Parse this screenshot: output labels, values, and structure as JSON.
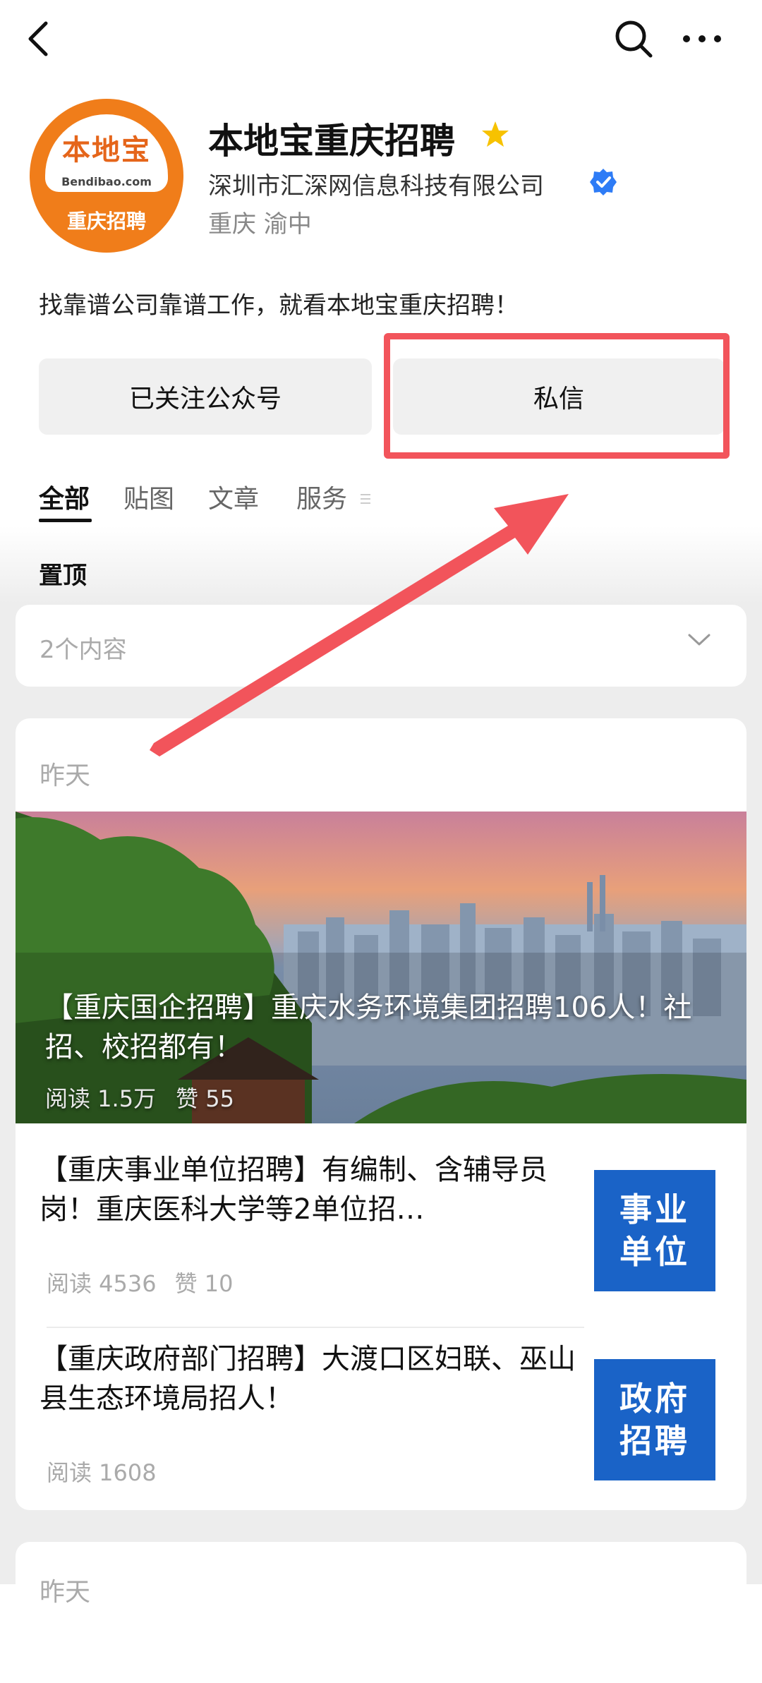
{
  "profile": {
    "avatar_line1": "本地宝",
    "avatar_line2": "Bendibao.com",
    "avatar_line3": "重庆招聘",
    "name": "本地宝重庆招聘",
    "company": "深圳市汇深网信息科技有限公司",
    "location": "重庆 渝中",
    "description": "找靠谱公司靠谱工作，就看本地宝重庆招聘！"
  },
  "actions": {
    "follow_label": "已关注公众号",
    "message_label": "私信"
  },
  "tabs": [
    "全部",
    "贴图",
    "文章",
    "服务"
  ],
  "pinned": {
    "label": "置顶",
    "count_text": "2个内容"
  },
  "feed": [
    {
      "date": "昨天",
      "hero": {
        "title": "【重庆国企招聘】重庆水务环境集团招聘106人！社招、校招都有！",
        "reads": "阅读 1.5万",
        "likes": "赞 55"
      },
      "articles": [
        {
          "title": "【重庆事业单位招聘】有编制、含辅导员岗！重庆医科大学等2单位招…",
          "reads": "阅读 4536",
          "likes": "赞 10",
          "thumb_line1": "事业",
          "thumb_line2": "单位"
        },
        {
          "title": "【重庆政府部门招聘】大渡口区妇联、巫山县生态环境局招人！",
          "reads": "阅读 1608",
          "thumb_line1": "政府",
          "thumb_line2": "招聘"
        }
      ]
    },
    {
      "date": "昨天"
    }
  ],
  "icons": {
    "back": "back-arrow-icon",
    "search": "search-icon",
    "more": "more-dots-icon",
    "star": "star-icon",
    "verified": "verified-badge-icon",
    "chevron": "chevron-down-icon"
  },
  "colors": {
    "avatar_orange": "#f07d1a",
    "highlight_red": "#f2545b",
    "thumb_blue": "#1a63c7",
    "verified_blue": "#2e7cf6",
    "star_yellow": "#f7c200"
  }
}
